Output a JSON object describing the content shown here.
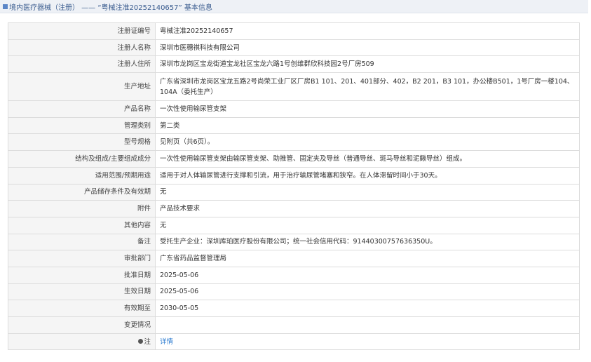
{
  "header": {
    "title": "境内医疗器械（注册） —— “粤械注准20252140657” 基本信息"
  },
  "rows": [
    {
      "label": "注册证编号",
      "value": "粤械注准20252140657"
    },
    {
      "label": "注册人名称",
      "value": "深圳市医穗祺科技有限公司"
    },
    {
      "label": "注册人住所",
      "value": "深圳市龙岗区宝龙街道宝龙社区宝龙六路1号创维群欣科技园2号厂房509"
    },
    {
      "label": "生产地址",
      "value": "广东省深圳市龙岗区宝龙五路2号尚荣工业厂区厂房B1 101、201、401部分、402，B2 201，B3 101，办公楼B501，1号厂房一楼104、104A（委托生产）"
    },
    {
      "label": "产品名称",
      "value": "一次性使用输尿管支架"
    },
    {
      "label": "管理类别",
      "value": "第二类"
    },
    {
      "label": "型号规格",
      "value": "见附页（共6页）。"
    },
    {
      "label": "结构及组成/主要组成成分",
      "value": "一次性使用输尿管支架由输尿管支架、助推管、固定夹及导丝（普通导丝、斑马导丝和泥鳅导丝）组成。"
    },
    {
      "label": "适用范围/预期用途",
      "value": "适用于对人体输尿管进行支撑和引流，用于治疗输尿管堵塞和狭窄。在人体滞留时间小于30天。"
    },
    {
      "label": "产品储存条件及有效期",
      "value": "无"
    },
    {
      "label": "附件",
      "value": "产品技术要求"
    },
    {
      "label": "其他内容",
      "value": "无"
    },
    {
      "label": "备注",
      "value": "受托生产企业：深圳库珀医疗股份有限公司；统一社会信用代码：91440300757636350U。"
    },
    {
      "label": "审批部门",
      "value": "广东省药品监督管理局"
    },
    {
      "label": "批准日期",
      "value": "2025-05-06"
    },
    {
      "label": "生效日期",
      "value": "2025-05-06"
    },
    {
      "label": "有效期至",
      "value": "2030-05-05"
    },
    {
      "label": "变更情况",
      "value": ""
    }
  ],
  "note_row": {
    "icon": "note-dot-icon",
    "label": "注",
    "link_text": "详情"
  }
}
